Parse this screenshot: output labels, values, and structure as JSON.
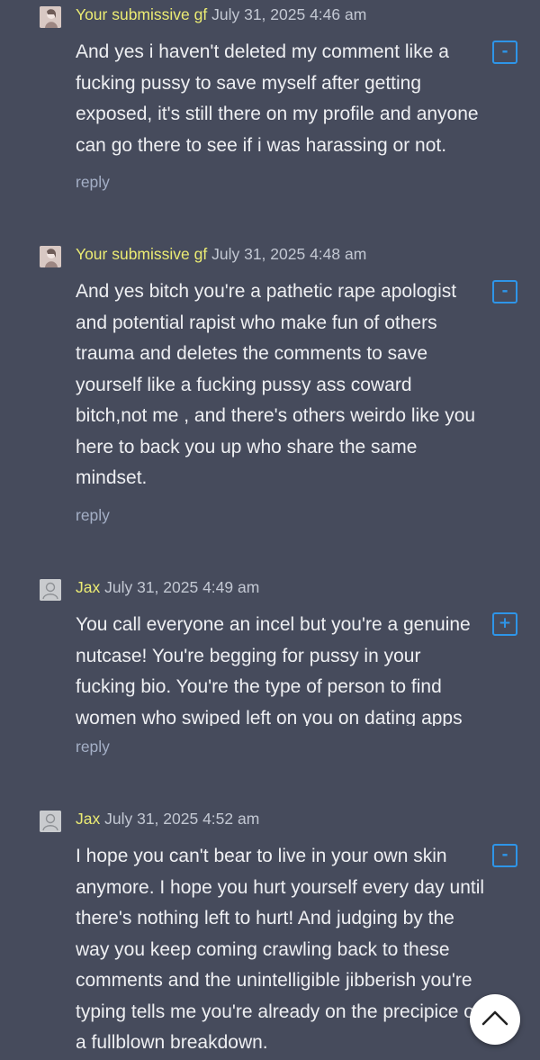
{
  "comments": [
    {
      "author": "Your submissive gf",
      "date": "July 31, 2025 4:46 am",
      "avatar": "user-photo",
      "toggle": "-",
      "lines": [
        "And yes i haven't deleted my comment like a",
        "fucking pussy to save myself after getting",
        "exposed, it's still there on my profile and anyone",
        "can go there to see if i was harassing or not."
      ],
      "reply": "reply"
    },
    {
      "author": "Your submissive gf",
      "date": "July 31, 2025 4:48 am",
      "avatar": "user-photo",
      "toggle": "-",
      "lines": [
        "And yes bitch you're a pathetic rape apologist",
        "and potential rapist who make fun of others",
        "trauma and deletes the comments to save",
        "yourself like a fucking pussy ass coward",
        "bitch,not me , and there's others weirdo like you",
        "here to back you up who share the same",
        "mindset."
      ],
      "reply": "reply"
    },
    {
      "author": "Jax",
      "date": "July 31, 2025 4:49 am",
      "avatar": "default-user",
      "toggle": "+",
      "lines": [
        "You call everyone an incel but you're a genuine",
        "nutcase! You're begging for pussy in your",
        "fucking bio. You're the type of person to find",
        "women who swiped left on you on dating apps"
      ],
      "reply": "reply"
    },
    {
      "author": "Jax",
      "date": "July 31, 2025 4:52 am",
      "avatar": "default-user",
      "toggle": "-",
      "lines": [
        "I hope you can't bear to live in your own skin",
        "anymore. I hope you hurt yourself every day until",
        "there's nothing left to hurt! And judging by the",
        "way you keep coming crawling back to these",
        "comments and the unintelligible jibberish you're",
        "typing tells me you're already on the precipice of",
        "a fullblown breakdown."
      ]
    }
  ],
  "scroll_top_icon": "chevron-up-icon"
}
